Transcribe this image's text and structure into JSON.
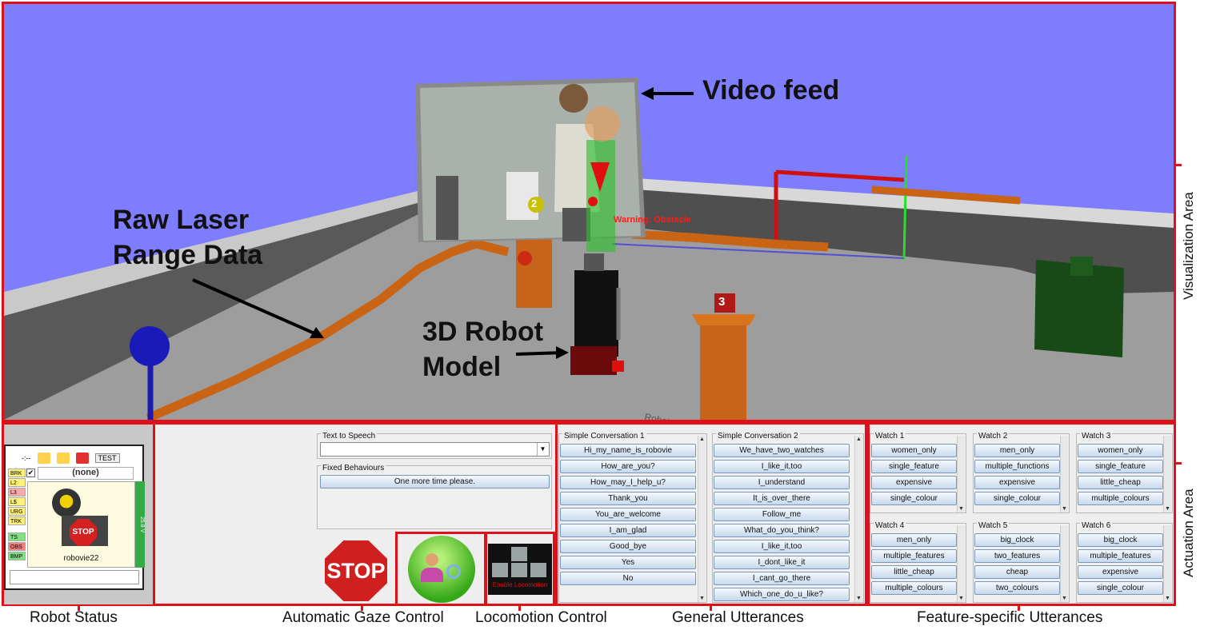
{
  "labels": {
    "visualization_area": "Visualization Area",
    "actuation_area": "Actuation Area",
    "video_feed": "Video feed",
    "raw_laser_line1": "Raw Laser",
    "raw_laser_line2": "Range Data",
    "robot_model_line1": "3D Robot",
    "robot_model_line2": "Model",
    "warning": "Warning: Obstacle",
    "marker_2": "2",
    "marker_3": "3"
  },
  "captions": {
    "robot_status": "Robot  Status",
    "gaze": "Automatic Gaze Control",
    "locomotion": "Locomotion Control",
    "general": "General Utterances",
    "feature": "Feature-specific Utterances"
  },
  "robot_status": {
    "time": "-:--",
    "test_label": "TEST",
    "robot_selector": "(none)",
    "robot_name": "robovie22",
    "stop_label": "STOP",
    "voltage": "25.8 V",
    "lamps": [
      {
        "label": "BRK",
        "color": "#fff27a"
      },
      {
        "label": "L2",
        "color": "#fff27a"
      },
      {
        "label": "L3",
        "color": "#f5a9a9"
      },
      {
        "label": "L$",
        "color": "#fff27a"
      },
      {
        "label": "URG",
        "color": "#fff27a"
      },
      {
        "label": "TRK",
        "color": "#fff27a"
      },
      {
        "label": "TS",
        "color": "#7fe07f"
      },
      {
        "label": "OBS",
        "color": "#f08080"
      },
      {
        "label": "BMP",
        "color": "#7fe07f"
      }
    ]
  },
  "tts": {
    "title": "Text to Speech",
    "value": "",
    "fixed_title": "Fixed Behaviours",
    "fixed_button": "One more time please."
  },
  "controls": {
    "stop": "STOP",
    "enable_locomotion": "Enable Locomotion"
  },
  "simple_conversation_1": {
    "title": "Simple Conversation 1",
    "items": [
      "Hi_my_name_is_robovie",
      "How_are_you?",
      "How_may_I_help_u?",
      "Thank_you",
      "You_are_welcome",
      "I_am_glad",
      "Good_bye",
      "Yes",
      "No"
    ]
  },
  "simple_conversation_2": {
    "title": "Simple Conversation 2",
    "items": [
      "We_have_two_watches",
      "I_like_it,too",
      "I_understand",
      "It_is_over_there",
      "Follow_me",
      "What_do_you_think?",
      "I_like_it,too",
      "I_dont_like_it",
      "I_cant_go_there",
      "Which_one_do_u_like?"
    ]
  },
  "watches": [
    {
      "title": "Watch 1",
      "items": [
        "women_only",
        "single_feature",
        "expensive",
        "single_colour"
      ]
    },
    {
      "title": "Watch 2",
      "items": [
        "men_only",
        "multiple_functions",
        "expensive",
        "single_colour"
      ]
    },
    {
      "title": "Watch 3",
      "items": [
        "women_only",
        "single_feature",
        "little_cheap",
        "multiple_colours"
      ]
    },
    {
      "title": "Watch 4",
      "items": [
        "men_only",
        "multiple_features",
        "little_cheap",
        "multiple_colours"
      ]
    },
    {
      "title": "Watch 5",
      "items": [
        "big_clock",
        "two_features",
        "cheap",
        "two_colours"
      ]
    },
    {
      "title": "Watch 6",
      "items": [
        "big_clock",
        "multiple_features",
        "expensive",
        "single_colour"
      ]
    }
  ],
  "colors": {
    "sky": "#7d7dfe",
    "accent_red": "#e0101a",
    "laser": "#c86414",
    "floor": "#9c9c9c"
  }
}
